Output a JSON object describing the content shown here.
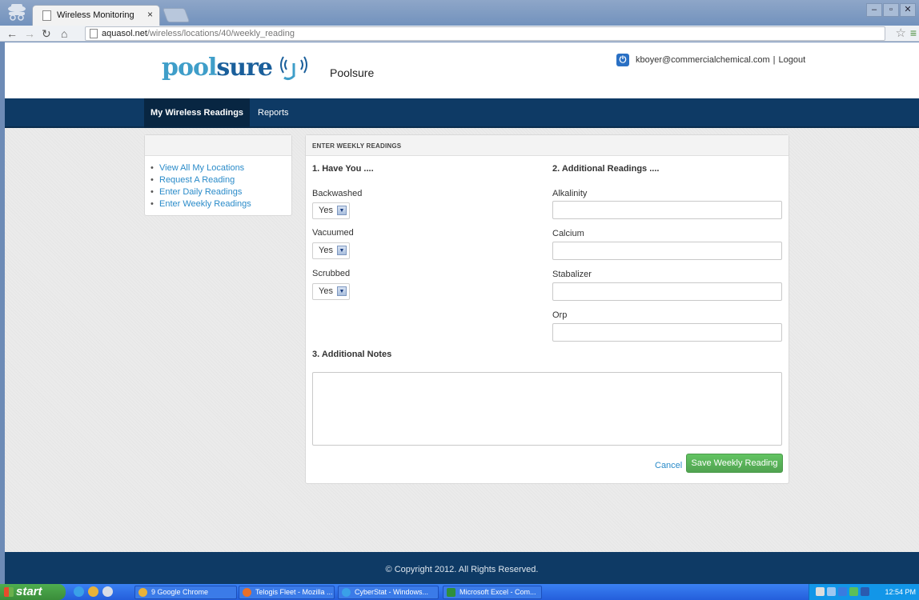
{
  "browser": {
    "tab_title": "Wireless Monitoring",
    "tab_close": "×",
    "url_host": "aquasol.net",
    "url_path": "/wireless/locations/40/weekly_reading"
  },
  "header": {
    "logo_part1": "pool",
    "logo_part2": "sure",
    "brand_name": "Poolsure",
    "user_email": "kboyer@commercialchemical.com",
    "separator": "|",
    "logout_label": "Logout"
  },
  "nav": {
    "items": [
      {
        "label": "My Wireless Readings"
      },
      {
        "label": "Reports"
      }
    ]
  },
  "sidebar": {
    "links": [
      {
        "label": "View All My Locations"
      },
      {
        "label": "Request A Reading"
      },
      {
        "label": "Enter Daily Readings"
      },
      {
        "label": "Enter Weekly Readings"
      }
    ]
  },
  "form": {
    "panel_title": "ENTER WEEKLY READINGS",
    "section1_title": "1. Have You ....",
    "section2_title": "2. Additional Readings ....",
    "section3_title": "3. Additional Notes",
    "selects": [
      {
        "label": "Backwashed",
        "value": "Yes"
      },
      {
        "label": "Vacuumed",
        "value": "Yes"
      },
      {
        "label": "Scrubbed",
        "value": "Yes"
      }
    ],
    "inputs": [
      {
        "label": "Alkalinity",
        "value": ""
      },
      {
        "label": "Calcium",
        "value": ""
      },
      {
        "label": "Stabalizer",
        "value": ""
      },
      {
        "label": "Orp",
        "value": ""
      }
    ],
    "notes_value": "",
    "cancel_label": "Cancel",
    "save_label": "Save Weekly Reading"
  },
  "footer": {
    "copyright": "© Copyright 2012. All Rights Reserved."
  },
  "taskbar": {
    "start_label": "start",
    "tasks": [
      {
        "label": "9 Google Chrome"
      },
      {
        "label": "Telogis Fleet - Mozilla ..."
      },
      {
        "label": "CyberStat - Windows..."
      },
      {
        "label": "Microsoft Excel - Com..."
      }
    ],
    "clock": "12:54 PM"
  },
  "colors": {
    "navbar": "#0e3a65",
    "link": "#2a8bc9",
    "save_button": "#5bb75b"
  }
}
